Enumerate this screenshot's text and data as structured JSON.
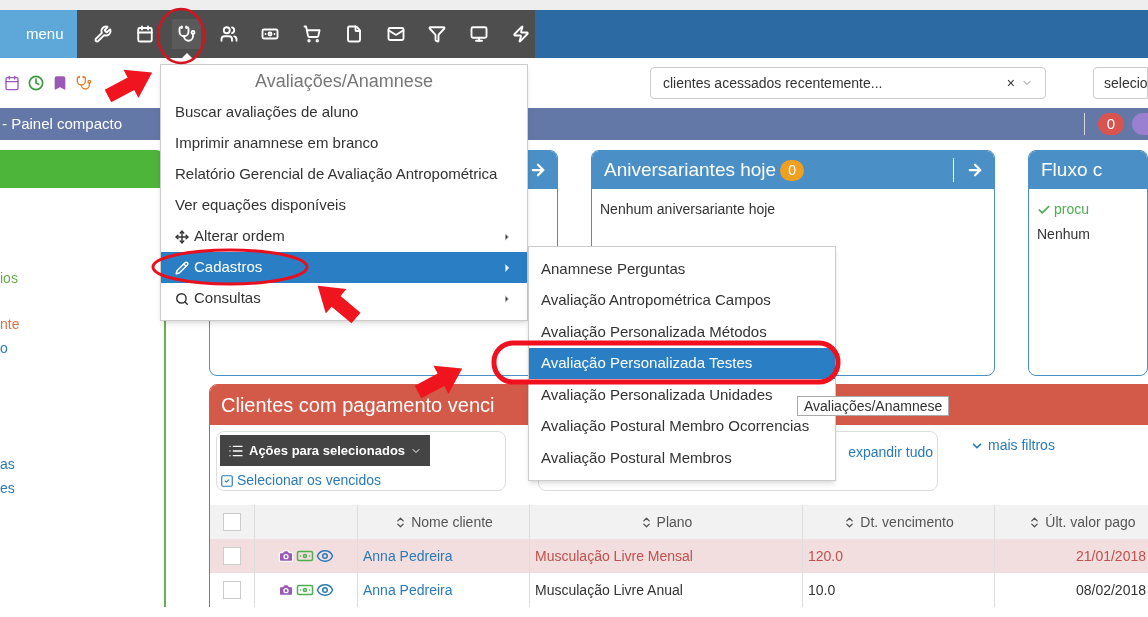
{
  "top_bar": {
    "menu_button": "menu",
    "tools": [
      {
        "selected": false
      },
      {
        "selected": false
      },
      {
        "selected": true
      },
      {
        "selected": false
      },
      {
        "selected": false
      },
      {
        "selected": false
      },
      {
        "selected": false
      },
      {
        "selected": false
      },
      {
        "selected": false
      },
      {
        "selected": false
      },
      {
        "selected": false
      }
    ]
  },
  "search_bar": {
    "client_select": {
      "value": "clientes acessados recentemente...",
      "clear": "×"
    },
    "second_select": {
      "value": "selecio"
    }
  },
  "panel_bar": {
    "title": "- Painel compacto",
    "badge": "0"
  },
  "sidebar": {
    "items": [
      {
        "label": "ios",
        "color": "#6aa84f"
      },
      {
        "label": "nte",
        "color": "#d9734a"
      },
      {
        "label": "o",
        "color": "#2a7ab8"
      },
      {
        "label": "as",
        "color": "#2a7ab8"
      },
      {
        "label": "es",
        "color": "#2a7ab8"
      }
    ]
  },
  "cards": [
    {
      "title": "Aniversariantes hoje",
      "badge": "0",
      "body": "Nenhum aniversariante hoje"
    },
    {
      "title": "Fluxo c",
      "filter": "procu",
      "body": "Nenhum"
    }
  ],
  "overdue_panel": {
    "title": "Clientes com pagamento venci",
    "actions_button": "Ações para selecionados",
    "select_overdue": {
      "label": "Selecionar os vencidos",
      "checked": true
    },
    "expand_link": "expandir tudo",
    "more_filters": "mais filtros",
    "table": {
      "select_all": {
        "checked": false
      },
      "columns": [
        "Nome cliente",
        "Plano",
        "Dt. vencimento",
        "Últ. valor pago"
      ],
      "rows": [
        {
          "client": "Anna Pedreira",
          "plan": "Musculação Livre Mensal",
          "due": "120.0",
          "last_paid": "21/01/2018",
          "overdue": true,
          "checked": false
        },
        {
          "client": "Anna Pedreira",
          "plan": "Musculação Livre Anual",
          "due": "10.0",
          "last_paid": "08/02/2018",
          "overdue": false,
          "checked": false
        }
      ]
    }
  },
  "dropdown_menu": {
    "title": "Avaliações/Anamnese",
    "items": [
      {
        "label": "Buscar avaliações de aluno",
        "kind": "plain",
        "selected": false
      },
      {
        "label": "Imprimir anamnese em branco",
        "kind": "plain",
        "selected": false
      },
      {
        "label": "Relatório Gerencial de Avaliação Antropométrica",
        "kind": "plain",
        "selected": false
      },
      {
        "label": "Ver equações disponíveis",
        "kind": "plain",
        "selected": false
      },
      {
        "label": "Alterar ordem",
        "kind": "submenu",
        "selected": false
      },
      {
        "label": "Cadastros",
        "kind": "submenu",
        "selected": true
      },
      {
        "label": "Consultas",
        "kind": "submenu",
        "selected": false
      }
    ]
  },
  "submenu": {
    "items": [
      {
        "label": "Anamnese Perguntas",
        "selected": false
      },
      {
        "label": "Avaliação Antropométrica Campos",
        "selected": false
      },
      {
        "label": "Avaliação Personalizada Métodos",
        "selected": false
      },
      {
        "label": "Avaliação Personalizada Testes",
        "selected": true
      },
      {
        "label": "Avaliação Personalizada Unidades",
        "selected": false
      },
      {
        "label": "Avaliação Postural Membro Ocorrencias",
        "selected": false
      },
      {
        "label": "Avaliação Postural Membros",
        "selected": false
      }
    ]
  },
  "tooltip": "Avaliações/Anamnese"
}
